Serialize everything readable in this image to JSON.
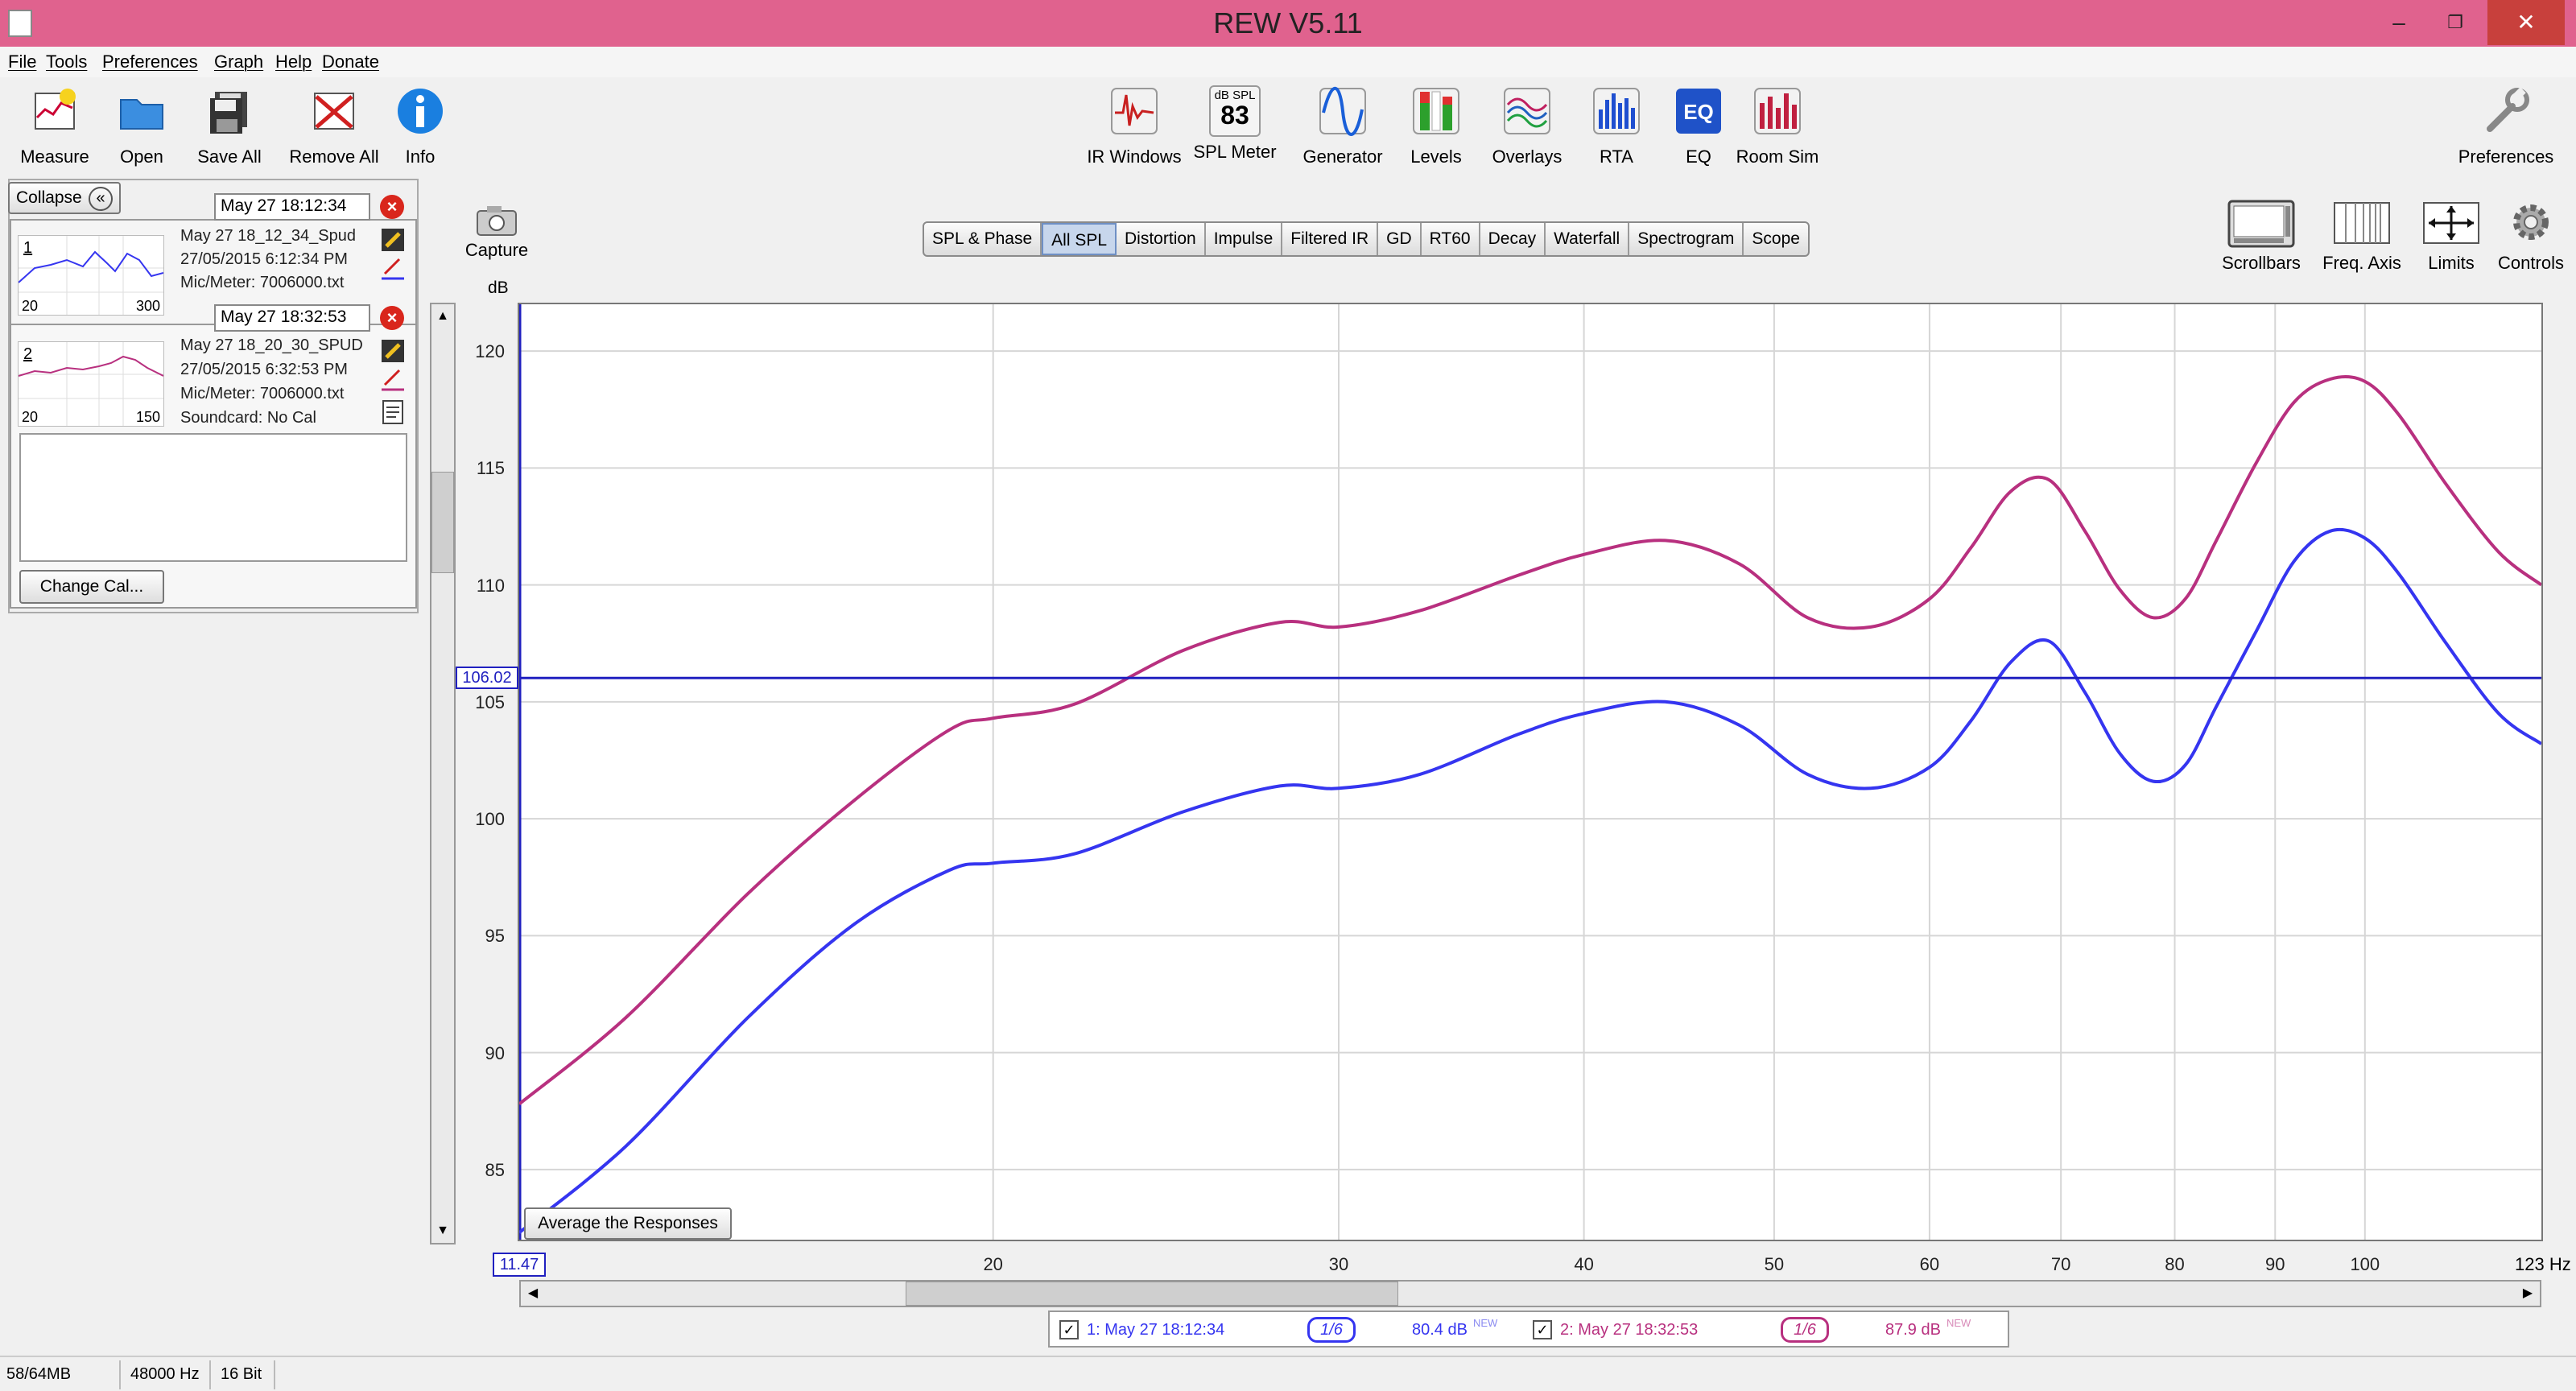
{
  "window": {
    "title": "REW V5.11",
    "min": "–",
    "max": "❐",
    "close": "✕"
  },
  "menu": [
    "File",
    "Tools",
    "Preferences",
    "Graph",
    "Help",
    "Donate"
  ],
  "toolbar_left": [
    {
      "label": "Measure",
      "icon": "measure-icon"
    },
    {
      "label": "Open",
      "icon": "folder-icon"
    },
    {
      "label": "Save All",
      "icon": "floppy-icon"
    },
    {
      "label": "Remove All",
      "icon": "remove-all-icon"
    },
    {
      "label": "Info",
      "icon": "info-icon"
    }
  ],
  "toolbar_center": [
    {
      "label": "IR Windows",
      "icon": "ir-windows-icon"
    },
    {
      "label": "SPL Meter",
      "icon": "spl-meter-icon",
      "top": "dB SPL",
      "value": "83"
    },
    {
      "label": "Generator",
      "icon": "generator-icon"
    },
    {
      "label": "Levels",
      "icon": "levels-icon"
    },
    {
      "label": "Overlays",
      "icon": "overlays-icon"
    },
    {
      "label": "RTA",
      "icon": "rta-icon"
    },
    {
      "label": "EQ",
      "icon": "eq-icon"
    },
    {
      "label": "Room Sim",
      "icon": "room-sim-icon"
    }
  ],
  "preferences": {
    "label": "Preferences",
    "icon": "wrench-icon"
  },
  "capture": {
    "label": "Capture",
    "icon": "camera-icon"
  },
  "graph_tools": [
    {
      "label": "Scrollbars",
      "icon": "scrollbars-icon"
    },
    {
      "label": "Freq. Axis",
      "icon": "freq-axis-icon"
    },
    {
      "label": "Limits",
      "icon": "limits-icon"
    },
    {
      "label": "Controls",
      "icon": "gear-icon"
    }
  ],
  "tabs": {
    "items": [
      "SPL & Phase",
      "All SPL",
      "Distortion",
      "Impulse",
      "Filtered IR",
      "GD",
      "RT60",
      "Decay",
      "Waterfall",
      "Spectrogram",
      "Scope"
    ],
    "selected": "All SPL"
  },
  "panel": {
    "collapse_label": "Collapse",
    "change_cal_label": "Change Cal..."
  },
  "measurements": [
    {
      "index": "1",
      "date_field": "May 27 18:12:34",
      "name": "May 27 18_12_34_Spud",
      "datetime": "27/05/2015 6:12:34 PM",
      "mic": "Mic/Meter: 7006000.txt",
      "thumb_min": "20",
      "thumb_max": "300",
      "color": "#3535f0"
    },
    {
      "index": "2",
      "date_field": "May 27 18:32:53",
      "name": "May 27 18_20_30_SPUD",
      "datetime": "27/05/2015 6:32:53 PM",
      "mic": "Mic/Meter: 7006000.txt",
      "soundcard": "Soundcard: No Cal",
      "thumb_min": "20",
      "thumb_max": "150",
      "color": "#b8307f"
    }
  ],
  "chart_data": {
    "type": "line",
    "ylabel": "dB",
    "xunit": "Hz",
    "xscale": "log",
    "xlim": [
      11.47,
      123
    ],
    "ylim": [
      82,
      122
    ],
    "grid": true,
    "yticks": [
      85,
      90,
      95,
      100,
      105,
      110,
      115,
      120
    ],
    "xticks": [
      20,
      30,
      40,
      50,
      60,
      70,
      80,
      90,
      100
    ],
    "cursor_y": "106.02",
    "cursor_x": "11.47",
    "x_end_label": "123 Hz",
    "series": [
      {
        "name": "1: May 27 18:12:34",
        "color": "#3535f0",
        "x": [
          11.47,
          13,
          15,
          17,
          19,
          20,
          22,
          25,
          28,
          30,
          33,
          37,
          40,
          44,
          48,
          52,
          56,
          60,
          63,
          66,
          69,
          72,
          75,
          78,
          81,
          84,
          88,
          92,
          96,
          100,
          104,
          110,
          117,
          123
        ],
        "y": [
          82.3,
          86,
          91.5,
          95.5,
          97.8,
          98.1,
          98.5,
          100.3,
          101.4,
          101.3,
          101.9,
          103.6,
          104.5,
          105.0,
          104.0,
          101.9,
          101.3,
          102.2,
          104.2,
          106.7,
          107.6,
          105.4,
          102.8,
          101.6,
          102.3,
          104.8,
          108.0,
          111.0,
          112.3,
          112.0,
          110.5,
          107.5,
          104.5,
          103.2
        ]
      },
      {
        "name": "2: May 27 18:32:53",
        "color": "#b8307f",
        "x": [
          11.47,
          13,
          15,
          17,
          19,
          20,
          22,
          25,
          28,
          30,
          33,
          37,
          40,
          44,
          48,
          52,
          56,
          60,
          63,
          66,
          69,
          72,
          75,
          78,
          81,
          84,
          88,
          92,
          96,
          100,
          104,
          110,
          117,
          123
        ],
        "y": [
          87.8,
          91.5,
          96.8,
          100.8,
          103.8,
          104.3,
          104.9,
          107.2,
          108.4,
          108.2,
          108.9,
          110.4,
          111.3,
          111.9,
          110.9,
          108.6,
          108.2,
          109.4,
          111.6,
          114.0,
          114.5,
          112.3,
          109.8,
          108.6,
          109.4,
          111.9,
          115.2,
          117.8,
          118.8,
          118.7,
          117.3,
          114.3,
          111.4,
          110.0
        ]
      }
    ]
  },
  "avg_button": "Average the Responses",
  "legend": [
    {
      "checkbox": "✓",
      "name": "1: May 27 18:12:34",
      "smoothing": "1/6",
      "level": "80.4 dB",
      "tag": "NEW",
      "color": "#3535f0"
    },
    {
      "checkbox": "✓",
      "name": "2: May 27 18:32:53",
      "smoothing": "1/6",
      "level": "87.9 dB",
      "tag": "NEW",
      "color": "#b8307f"
    }
  ],
  "status": {
    "memory": "58/64MB",
    "rate": "48000 Hz",
    "bits": "16 Bit"
  }
}
